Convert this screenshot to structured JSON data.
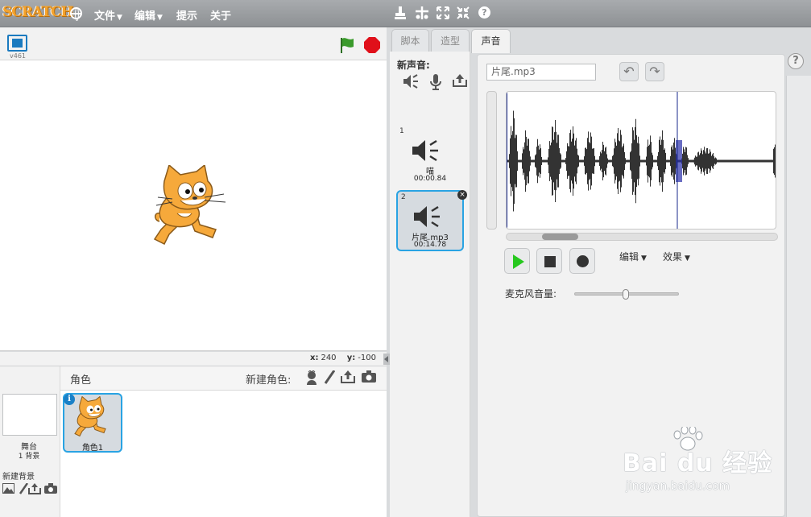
{
  "menubar": {
    "logo": "SCRATCH",
    "file": "文件",
    "edit": "编辑",
    "tips": "提示",
    "about": "关于",
    "tools": [
      "stamp-icon",
      "cut-icon",
      "grow-icon",
      "shrink-icon",
      "help-icon"
    ],
    "help_glyph": "?"
  },
  "stage": {
    "version": "v461",
    "coords": {
      "x_label": "x:",
      "x": "240",
      "y_label": "y:",
      "y": "-100"
    }
  },
  "sprites": {
    "title": "角色",
    "new_sprite": "新建角色:",
    "stage_label": "舞台",
    "stage_sub": "1 背景",
    "new_backdrop": "新建背景",
    "sprite_name": "角色1",
    "info_glyph": "i"
  },
  "tabs": {
    "scripts": "脚本",
    "costumes": "造型",
    "sounds": "声音"
  },
  "sound_panel": {
    "new_sound": "新声音:",
    "items": [
      {
        "num": "1",
        "name": "喵",
        "duration": "00:00.84"
      },
      {
        "num": "2",
        "name": "片尾.mp3",
        "duration": "00:14.78"
      }
    ],
    "delete_glyph": "×"
  },
  "editor": {
    "sound_name": "片尾.mp3",
    "undo_glyph": "↶",
    "redo_glyph": "↷",
    "edit_menu": "编辑",
    "effects_menu": "效果",
    "mic_volume_label": "麦克风音量:",
    "mic_volume_level": 0.48,
    "scroll_position": 0.13
  },
  "watermark": {
    "line1": "Bai du 经验",
    "line2": "jingyan.baidu.com"
  },
  "colors": {
    "accent": "#29a3e3",
    "play": "#26c81e",
    "stop": "#e0101a",
    "flag": "#3a9a2b"
  }
}
